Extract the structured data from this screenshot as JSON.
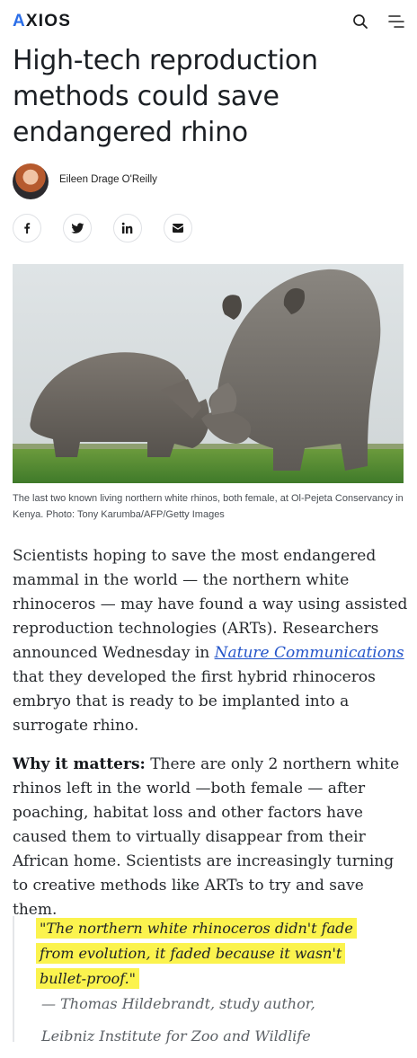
{
  "header": {
    "logo_text_a": "A",
    "logo_text_b": "XIOS",
    "search_icon": "search-icon",
    "menu_icon": "hamburger-menu-icon"
  },
  "article": {
    "title": "High-tech reproduction methods could save endangered rhino",
    "author": "Eileen Drage O'Reilly",
    "share": [
      "facebook-icon",
      "twitter-icon",
      "linkedin-icon",
      "email-icon"
    ],
    "caption": "The last two known living northern white rhinos, both female, at Ol-Pejeta Conservancy in Kenya. Photo: Tony Karumba/AFP/Getty Images",
    "p1_before": "Scientists hoping to save the most endangered mammal in the world — the northern white rhinoceros — may have found a way using assisted reproduction technologies (ARTs). Researchers announced Wednesday in ",
    "p1_link": "Nature Communications",
    "p1_after": " that they developed the first hybrid rhinoceros embryo that is ready to be implanted into a surrogate rhino.",
    "p2_lead": "Why it matters:",
    "p2_body": " There are only 2 northern white rhinos left in the world —both female — after poaching, habitat loss and other factors have caused them to virtually disappear from their African home. Scientists are increasingly turning to creative methods like ARTs to try and save them.",
    "quote": "\"The northern white rhinoceros didn't fade from evolution, it faded because it wasn't bullet-proof.\"",
    "attribution": "— Thomas Hildebrandt, study author, Leibniz Institute for Zoo and Wildlife Research"
  },
  "colors": {
    "logo_accent": "#2b6ee8",
    "link": "#2354c9",
    "highlight": "#fbf34e"
  }
}
